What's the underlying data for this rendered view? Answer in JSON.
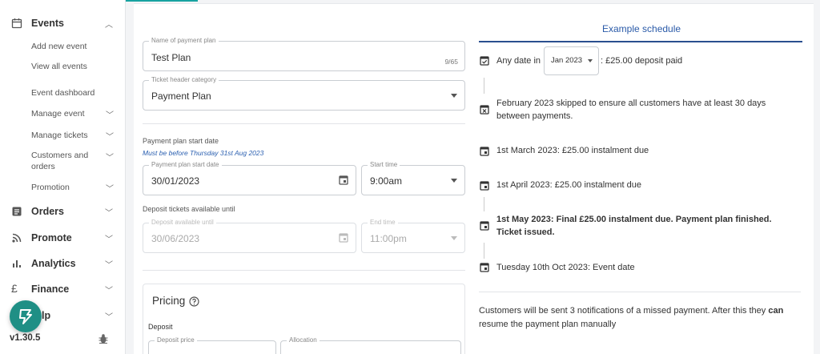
{
  "sidebar": {
    "events_label": "Events",
    "sub_items": [
      {
        "label": "Add new event"
      },
      {
        "label": "View all events"
      },
      {
        "label": "Event dashboard"
      },
      {
        "label": "Manage event"
      },
      {
        "label": "Manage tickets"
      },
      {
        "label": "Customers and orders"
      },
      {
        "label": "Promotion"
      }
    ],
    "sections": [
      {
        "label": "Orders",
        "icon": "orders-icon"
      },
      {
        "label": "Promote",
        "icon": "rss-icon"
      },
      {
        "label": "Analytics",
        "icon": "analytics-icon"
      },
      {
        "label": "Finance",
        "icon": "pound-icon"
      },
      {
        "label": "Help",
        "icon": "help-icon"
      }
    ],
    "help_partial": "lp",
    "version": "v1.30.5"
  },
  "form": {
    "plan_name_label": "Name of payment plan",
    "plan_name_value": "Test Plan",
    "plan_name_counter": "9/65",
    "ticket_header_label": "Ticket header category",
    "ticket_header_value": "Payment Plan",
    "start_date_heading": "Payment plan start date",
    "start_date_hint": "Must be before Thursday 31st Aug 2023",
    "start_date_label": "Payment plan start date",
    "start_date_value": "30/01/2023",
    "start_time_label": "Start time",
    "start_time_value": "9:00am",
    "deposit_heading": "Deposit tickets available until",
    "deposit_until_label": "Deposit available until",
    "deposit_until_value": "30/06/2023",
    "end_time_label": "End time",
    "end_time_value": "11:00pm",
    "pricing_title": "Pricing",
    "deposit_label": "Deposit",
    "deposit_price_label": "Deposit price",
    "allocation_label": "Allocation"
  },
  "schedule": {
    "title": "Example schedule",
    "first_prefix": "Any date in",
    "month_select": "Jan 2023",
    "first_suffix": ": £25.00 deposit paid",
    "items": [
      {
        "text": "February 2023 skipped to ensure all customers have at least 30 days between payments.",
        "icon": "calendar-x-icon"
      },
      {
        "text": "1st March 2023: £25.00 instalment due",
        "icon": "calendar-icon"
      },
      {
        "text": "1st April 2023: £25.00 instalment due",
        "icon": "calendar-icon"
      },
      {
        "text": "1st May 2023: Final £25.00 instalment due. Payment plan finished. Ticket issued.",
        "icon": "calendar-icon"
      },
      {
        "text": "Tuesday 10th Oct 2023: Event date",
        "icon": "calendar-icon"
      }
    ],
    "note_pre": "Customers will be sent 3 notifications of a missed payment. After this they ",
    "note_bold": "can",
    "note_post": " resume the payment plan manually"
  },
  "colors": {
    "accent": "#17a2a0",
    "link_blue": "#2a5aa8",
    "fab": "#1f8f85"
  }
}
